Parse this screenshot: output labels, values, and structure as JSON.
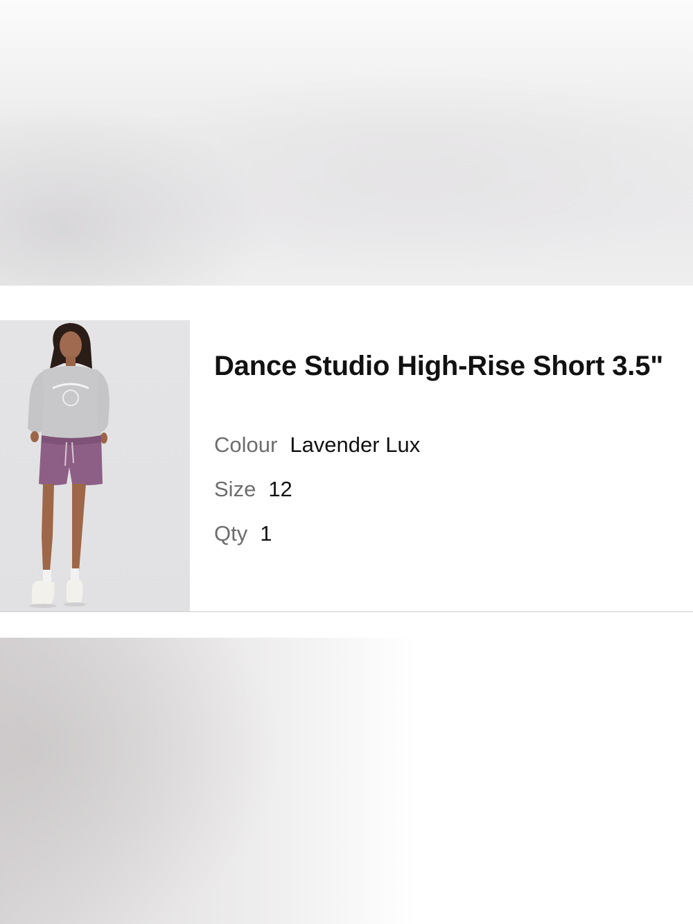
{
  "product": {
    "title": "Dance Studio High-Rise Short 3.5\"",
    "image_alt": "Model wearing lavender shorts and grey sweatshirt",
    "attributes": [
      {
        "label": "Colour",
        "value": "Lavender Lux"
      },
      {
        "label": "Size",
        "value": "12"
      },
      {
        "label": "Qty",
        "value": "1"
      }
    ]
  },
  "colors": {
    "shorts": "#8e5f86",
    "sweatshirt": "#c9c9cb",
    "background": "#e3e3e5"
  }
}
